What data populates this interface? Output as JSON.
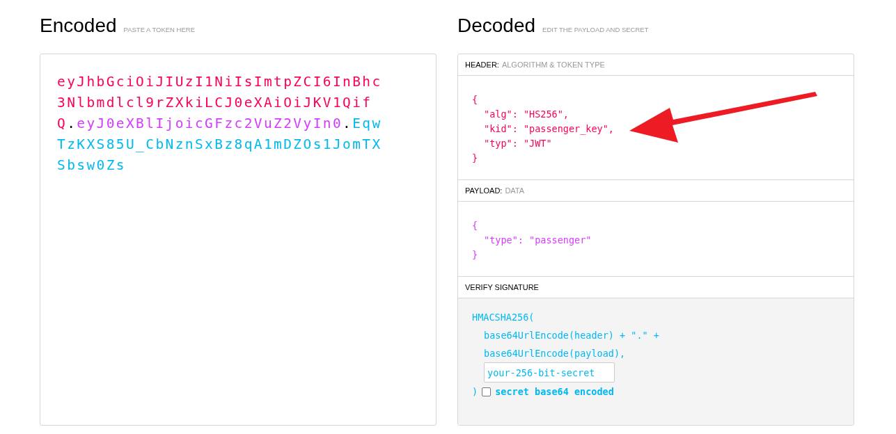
{
  "encoded": {
    "title": "Encoded",
    "hint": "PASTE A TOKEN HERE",
    "token": [
      {
        "text": "eyJhbGciOiJIUzI1NiIsImtpZCI6InBhc3Nlbmdlcl9rZXkiLCJ0eXAiOiJKV1QifQ",
        "kind": "header"
      },
      {
        "text": ".",
        "kind": "dot"
      },
      {
        "text": "eyJ0eXBlIjoicGFzc2VuZ2VyIn0",
        "kind": "payload"
      },
      {
        "text": ".",
        "kind": "dot"
      },
      {
        "text": "EqwTzKXS85U_CbNznSxBz8qA1mDZOs1JomTXSbsw0Zs",
        "kind": "signature"
      }
    ]
  },
  "decoded": {
    "title": "Decoded",
    "hint": "EDIT THE PAYLOAD AND SECRET",
    "sections": [
      {
        "kind": "header",
        "label": "HEADER:",
        "sublabel": "ALGORITHM & TOKEN TYPE",
        "open": "{",
        "entries": [
          "\"alg\": \"HS256\",",
          "\"kid\": \"passenger_key\",",
          "\"typ\": \"JWT\""
        ],
        "close": "}"
      },
      {
        "kind": "payload",
        "label": "PAYLOAD:",
        "sublabel": "DATA",
        "open": "{",
        "entries": [
          "\"type\": \"passenger\""
        ],
        "close": "}"
      },
      {
        "kind": "verify",
        "label": "VERIFY SIGNATURE",
        "open": "HMACSHA256(",
        "entries": [
          "base64UrlEncode(header) + \".\" +",
          "base64UrlEncode(payload),"
        ],
        "secret": {
          "value": "your-256-bit-secret"
        },
        "close": ")",
        "base64": {
          "label": "secret base64 encoded",
          "checked": false
        }
      }
    ]
  }
}
